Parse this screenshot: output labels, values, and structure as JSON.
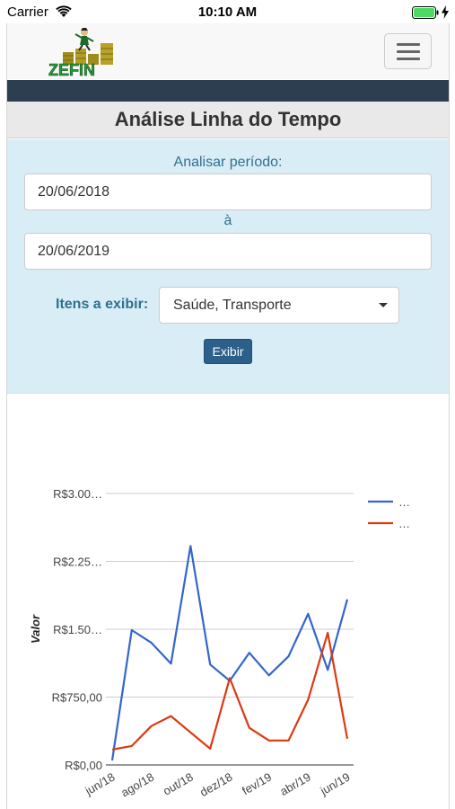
{
  "status_bar": {
    "carrier": "Carrier",
    "time": "10:10 AM"
  },
  "header": {
    "logo_text": "ZEFIN",
    "menu_icon": "hamburger-menu-icon"
  },
  "page": {
    "title": "Análise Linha do Tempo"
  },
  "filter": {
    "period_label": "Analisar período:",
    "start_date": "20/06/2018",
    "to_label": "à",
    "end_date": "20/06/2019",
    "items_label": "Itens a exibir:",
    "items_selected": "Saúde, Transporte",
    "show_button": "Exibir"
  },
  "colors": {
    "series_1": "#3366cc",
    "series_2": "#dc3912",
    "navy": "#2c3e50",
    "panel": "#d9edf7"
  },
  "chart_data": {
    "type": "line",
    "ylabel": "Valor",
    "ylim": [
      0,
      3000
    ],
    "y_ticks": [
      {
        "value": 0,
        "label": "R$0,00"
      },
      {
        "value": 750,
        "label": "R$750,00"
      },
      {
        "value": 1500,
        "label": "R$1.50…"
      },
      {
        "value": 2250,
        "label": "R$2.25…"
      },
      {
        "value": 3000,
        "label": "R$3.00…"
      }
    ],
    "x_tick_labels": [
      "jun/18",
      "ago/18",
      "out/18",
      "dez/18",
      "fev/19",
      "abr/19",
      "jun/19"
    ],
    "x": [
      "jun/18",
      "jul/18",
      "ago/18",
      "set/18",
      "out/18",
      "nov/18",
      "dez/18",
      "jan/19",
      "fev/19",
      "mar/19",
      "abr/19",
      "mai/19",
      "jun/19"
    ],
    "legend": [
      "…",
      "…"
    ],
    "legend_position": "right",
    "grid": true,
    "series": [
      {
        "values": [
          50,
          1490,
          1350,
          1120,
          2420,
          1110,
          930,
          1240,
          990,
          1200,
          1670,
          1050,
          1830
        ]
      },
      {
        "values": [
          170,
          210,
          430,
          540,
          360,
          180,
          960,
          410,
          270,
          270,
          720,
          1460,
          290
        ]
      }
    ]
  }
}
